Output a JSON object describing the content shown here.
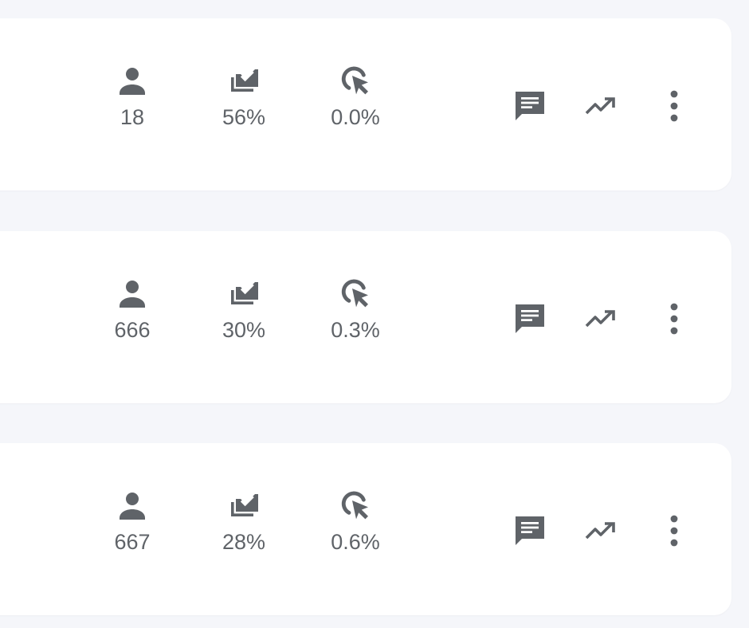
{
  "colors": {
    "page_background": "#f5f6fa",
    "card_background": "#ffffff",
    "icon_color": "#5f6368",
    "text_color": "#5f6368"
  },
  "icons": {
    "people": "person-icon",
    "completion": "inbox-check-icon",
    "clicks": "cursor-click-icon",
    "comments": "comment-icon",
    "trend": "trending-up-icon",
    "menu": "more-vert-icon"
  },
  "rows": [
    {
      "people": "18",
      "completion": "56%",
      "clicks": "0.0%"
    },
    {
      "people": "666",
      "completion": "30%",
      "clicks": "0.3%"
    },
    {
      "people": "667",
      "completion": "28%",
      "clicks": "0.6%"
    }
  ]
}
